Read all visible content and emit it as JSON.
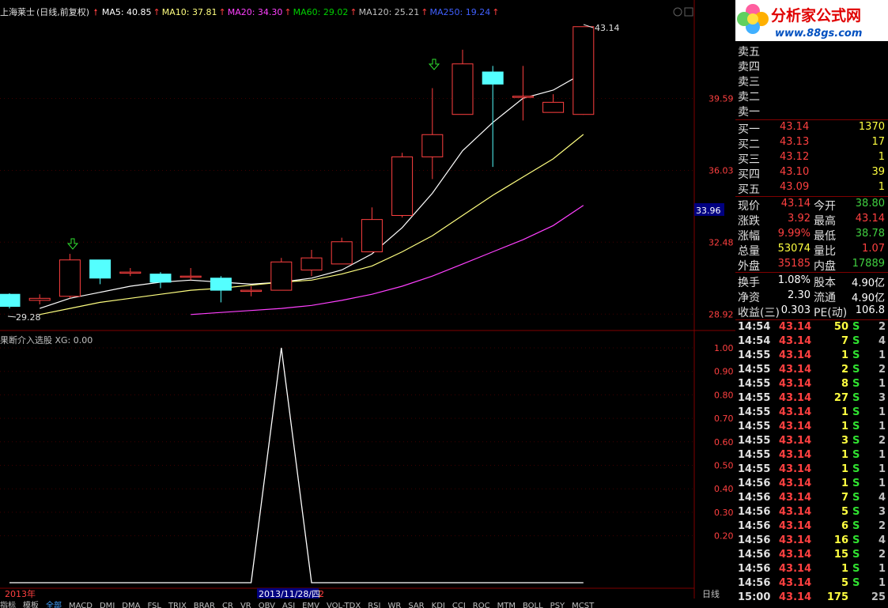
{
  "stock": {
    "name": "上海莱士",
    "mode": "(日线,前复权)"
  },
  "ma_legend": [
    {
      "label": "MA5: 40.85",
      "color": "#ffffff"
    },
    {
      "label": "MA10: 37.81",
      "color": "#ffff80"
    },
    {
      "label": "MA20: 34.30",
      "color": "#ff40ff"
    },
    {
      "label": "MA60: 29.02",
      "color": "#00d000"
    },
    {
      "label": "MA120: 25.21",
      "color": "#c0c0c0"
    },
    {
      "label": "MA250: 19.24",
      "color": "#4060ff"
    }
  ],
  "price_axis": {
    "labels": [
      "39.59",
      "36.03",
      "32.48",
      "28.92"
    ],
    "current_price_tag": "33.96"
  },
  "annotations": {
    "high_marker": "43.14",
    "low_marker": "29.28"
  },
  "indicator": {
    "title": "果断介入选股  XG: 0.00",
    "axis_labels": [
      "1.00",
      "0.90",
      "0.80",
      "0.70",
      "0.60",
      "0.50",
      "0.40",
      "0.30",
      "0.20"
    ]
  },
  "date_axis": {
    "year_label": "2013年",
    "cursor_date": "2013/11/28/四",
    "cursor_suffix": "2"
  },
  "period_label": "日线",
  "bottom_tabs": [
    "指标",
    "模板",
    "全部",
    "MACD",
    "DMI",
    "DMA",
    "FSL",
    "TRIX",
    "BRAR",
    "CR",
    "VR",
    "OBV",
    "ASI",
    "EMV",
    "VOL-TDX",
    "RSI",
    "WR",
    "SAR",
    "KDJ",
    "CCI",
    "ROC",
    "MTM",
    "BOLL",
    "PSY",
    "MCST"
  ],
  "logo": {
    "title": "分析家公式网",
    "url": "www.88gs.com"
  },
  "order_book": {
    "sell": [
      {
        "label": "卖五"
      },
      {
        "label": "卖四"
      },
      {
        "label": "卖三"
      },
      {
        "label": "卖二"
      },
      {
        "label": "卖一"
      }
    ],
    "buy": [
      {
        "label": "买一",
        "price": "43.14",
        "vol": "1370"
      },
      {
        "label": "买二",
        "price": "43.13",
        "vol": "17"
      },
      {
        "label": "买三",
        "price": "43.12",
        "vol": "1"
      },
      {
        "label": "买四",
        "price": "43.10",
        "vol": "39"
      },
      {
        "label": "买五",
        "price": "43.09",
        "vol": "1"
      }
    ]
  },
  "quote_rows": [
    {
      "l1": "现价",
      "v1": "43.14",
      "c1": "#ff4040",
      "l2": "今开",
      "v2": "38.80",
      "c2": "#40d040"
    },
    {
      "l1": "涨跌",
      "v1": "3.92",
      "c1": "#ff4040",
      "l2": "最高",
      "v2": "43.14",
      "c2": "#ff4040"
    },
    {
      "l1": "涨幅",
      "v1": "9.99%",
      "c1": "#ff4040",
      "l2": "最低",
      "v2": "38.78",
      "c2": "#40d040"
    },
    {
      "l1": "总量",
      "v1": "53074",
      "c1": "#ffff40",
      "l2": "量比",
      "v2": "1.07",
      "c2": "#ff4040"
    },
    {
      "l1": "外盘",
      "v1": "35185",
      "c1": "#ff4040",
      "l2": "内盘",
      "v2": "17889",
      "c2": "#40d040"
    }
  ],
  "fund_rows": [
    {
      "l1": "换手",
      "v1": "1.08%",
      "l2": "股本",
      "v2": "4.90亿"
    },
    {
      "l1": "净资",
      "v1": "2.30",
      "l2": "流通",
      "v2": "4.90亿"
    },
    {
      "l1": "收益(三)",
      "v1": "0.303",
      "l2": "PE(动)",
      "v2": "106.8"
    }
  ],
  "trades": [
    {
      "time": "14:54",
      "price": "43.14",
      "vol": "50",
      "flag": "S",
      "n": "2"
    },
    {
      "time": "14:54",
      "price": "43.14",
      "vol": "7",
      "flag": "S",
      "n": "4"
    },
    {
      "time": "14:55",
      "price": "43.14",
      "vol": "1",
      "flag": "S",
      "n": "1"
    },
    {
      "time": "14:55",
      "price": "43.14",
      "vol": "2",
      "flag": "S",
      "n": "2"
    },
    {
      "time": "14:55",
      "price": "43.14",
      "vol": "8",
      "flag": "S",
      "n": "1"
    },
    {
      "time": "14:55",
      "price": "43.14",
      "vol": "27",
      "flag": "S",
      "n": "3"
    },
    {
      "time": "14:55",
      "price": "43.14",
      "vol": "1",
      "flag": "S",
      "n": "1"
    },
    {
      "time": "14:55",
      "price": "43.14",
      "vol": "1",
      "flag": "S",
      "n": "1"
    },
    {
      "time": "14:55",
      "price": "43.14",
      "vol": "3",
      "flag": "S",
      "n": "2"
    },
    {
      "time": "14:55",
      "price": "43.14",
      "vol": "1",
      "flag": "S",
      "n": "1"
    },
    {
      "time": "14:55",
      "price": "43.14",
      "vol": "1",
      "flag": "S",
      "n": "1"
    },
    {
      "time": "14:56",
      "price": "43.14",
      "vol": "1",
      "flag": "S",
      "n": "1"
    },
    {
      "time": "14:56",
      "price": "43.14",
      "vol": "7",
      "flag": "S",
      "n": "4"
    },
    {
      "time": "14:56",
      "price": "43.14",
      "vol": "5",
      "flag": "S",
      "n": "3"
    },
    {
      "time": "14:56",
      "price": "43.14",
      "vol": "6",
      "flag": "S",
      "n": "2"
    },
    {
      "time": "14:56",
      "price": "43.14",
      "vol": "16",
      "flag": "S",
      "n": "4"
    },
    {
      "time": "14:56",
      "price": "43.14",
      "vol": "15",
      "flag": "S",
      "n": "2"
    },
    {
      "time": "14:56",
      "price": "43.14",
      "vol": "1",
      "flag": "S",
      "n": "1"
    },
    {
      "time": "14:56",
      "price": "43.14",
      "vol": "5",
      "flag": "S",
      "n": "1"
    },
    {
      "time": "15:00",
      "price": "43.14",
      "vol": "175",
      "flag": "",
      "n": "25"
    }
  ],
  "chart_data": {
    "type": "candlestick",
    "candles": [
      {
        "o": 29.9,
        "c": 29.3,
        "h": 29.95,
        "l": 29.2
      },
      {
        "o": 29.6,
        "c": 29.7,
        "h": 29.9,
        "l": 29.4
      },
      {
        "o": 29.8,
        "c": 31.6,
        "h": 31.9,
        "l": 29.7
      },
      {
        "o": 31.6,
        "c": 30.7,
        "h": 31.6,
        "l": 30.4
      },
      {
        "o": 31.0,
        "c": 31.0,
        "h": 31.2,
        "l": 30.8
      },
      {
        "o": 30.9,
        "c": 30.5,
        "h": 31.0,
        "l": 30.2
      },
      {
        "o": 30.8,
        "c": 30.8,
        "h": 31.2,
        "l": 30.6
      },
      {
        "o": 30.7,
        "c": 30.1,
        "h": 30.8,
        "l": 29.5
      },
      {
        "o": 30.1,
        "c": 30.1,
        "h": 30.3,
        "l": 29.8
      },
      {
        "o": 30.1,
        "c": 31.5,
        "h": 31.7,
        "l": 30.1
      },
      {
        "o": 31.1,
        "c": 31.7,
        "h": 32.1,
        "l": 30.8
      },
      {
        "o": 31.4,
        "c": 32.5,
        "h": 32.7,
        "l": 31.4
      },
      {
        "o": 32.0,
        "c": 33.6,
        "h": 34.2,
        "l": 32.0
      },
      {
        "o": 33.8,
        "c": 36.7,
        "h": 36.9,
        "l": 33.7
      },
      {
        "o": 36.7,
        "c": 37.8,
        "h": 40.1,
        "l": 35.6
      },
      {
        "o": 38.8,
        "c": 41.3,
        "h": 42.0,
        "l": 38.8
      },
      {
        "o": 40.9,
        "c": 40.3,
        "h": 41.2,
        "l": 36.2
      },
      {
        "o": 39.7,
        "c": 39.7,
        "h": 41.2,
        "l": 38.5
      },
      {
        "o": 38.9,
        "c": 39.4,
        "h": 39.8,
        "l": 38.9
      },
      {
        "o": 38.8,
        "c": 43.14,
        "h": 43.14,
        "l": 38.78
      }
    ],
    "ma_series": [
      {
        "name": "MA5",
        "color": "#ffffff",
        "values": [
          null,
          29.2,
          29.7,
          30.0,
          30.3,
          30.5,
          30.6,
          30.5,
          30.4,
          30.5,
          30.7,
          31.1,
          31.9,
          33.2,
          34.9,
          37.0,
          38.4,
          39.6,
          40.0,
          40.85
        ]
      },
      {
        "name": "MA10",
        "color": "#ffff80",
        "values": [
          null,
          28.9,
          29.2,
          29.5,
          29.7,
          29.9,
          30.1,
          30.2,
          30.35,
          30.5,
          30.6,
          30.9,
          31.3,
          32.0,
          32.8,
          33.8,
          34.8,
          35.7,
          36.6,
          37.81
        ]
      },
      {
        "name": "MA20",
        "color": "#ff40ff",
        "values": [
          null,
          null,
          null,
          null,
          null,
          null,
          28.9,
          29.0,
          29.1,
          29.2,
          29.35,
          29.6,
          29.9,
          30.3,
          30.8,
          31.4,
          32.0,
          32.6,
          33.3,
          34.3
        ]
      }
    ],
    "ylim": [
      28.5,
      43.6
    ],
    "indicator_series": {
      "name": "XG",
      "values": [
        0,
        0,
        0,
        0,
        0,
        0,
        0,
        0,
        0,
        1,
        0,
        0,
        0,
        0,
        0,
        0,
        0,
        0,
        0,
        0
      ],
      "ylim": [
        0,
        1.05
      ]
    }
  }
}
